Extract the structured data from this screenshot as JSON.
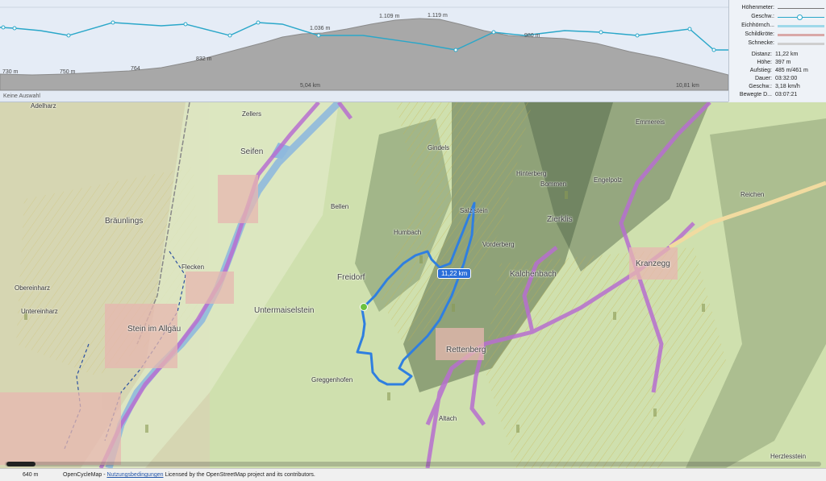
{
  "profile": {
    "y_ticks": [
      {
        "label": "730 m"
      },
      {
        "label": "750 m"
      },
      {
        "label": "764"
      },
      {
        "label": "832 m"
      },
      {
        "label": "1.036 m"
      },
      {
        "label": "1.109 m"
      },
      {
        "label": "1.119 m"
      },
      {
        "label": "980 m"
      }
    ],
    "x_ticks": [
      {
        "label": "5,04 km"
      },
      {
        "label": "10,81 km"
      }
    ],
    "selection_status": "Keine Auswahl"
  },
  "legend": {
    "items": [
      {
        "label": "Höhenmeter:",
        "color": "#777777"
      },
      {
        "label": "Geschw.:",
        "color": "#2aa7c9"
      },
      {
        "label": "Eichhörnch...",
        "color": "#9fd9ea"
      },
      {
        "label": "Schildkröte:",
        "color": "#d9a8a8"
      },
      {
        "label": "Schnecke:",
        "color": "#cfcfcf"
      }
    ]
  },
  "stats": [
    {
      "label": "Distanz:",
      "value": "11,22 km"
    },
    {
      "label": "Höhe:",
      "value": "397 m"
    },
    {
      "label": "Aufstieg:",
      "value": "485 m/461 m"
    },
    {
      "label": "Dauer:",
      "value": "03:32:00"
    },
    {
      "label": "Geschw.:",
      "value": "3,18 km/h"
    },
    {
      "label": "Bewegte D...",
      "value": "03:07:21"
    }
  ],
  "map": {
    "places": [
      "Adelharz",
      "Zellers",
      "Seifen",
      "Bräunlings",
      "Flecken",
      "Obereinharz",
      "Untereinharz",
      "Stein im Allgäu",
      "Bellen",
      "Humbach",
      "Freidorf",
      "Untermaiselstein",
      "Greggenhofen",
      "Gindels",
      "Hinterberg",
      "Bommen",
      "Emmereis",
      "Engelpolz",
      "Reichen",
      "Zierklis",
      "Vorderberg",
      "Kalchenbach",
      "Kranzegg",
      "Rettenberg",
      "Altach",
      "Salz stein",
      "Herzlesstein"
    ],
    "route_distance": "11,22 km",
    "route_color": "#2f7fe0",
    "road_color": "#b76fd0"
  },
  "bottom": {
    "scale": "640 m",
    "attribution_prefix": "OpenCycleMap - ",
    "attribution_link": "Nutzungsbedingungen",
    "attribution_suffix": " Licensed by the OpenStreetMap project and its contributors."
  }
}
